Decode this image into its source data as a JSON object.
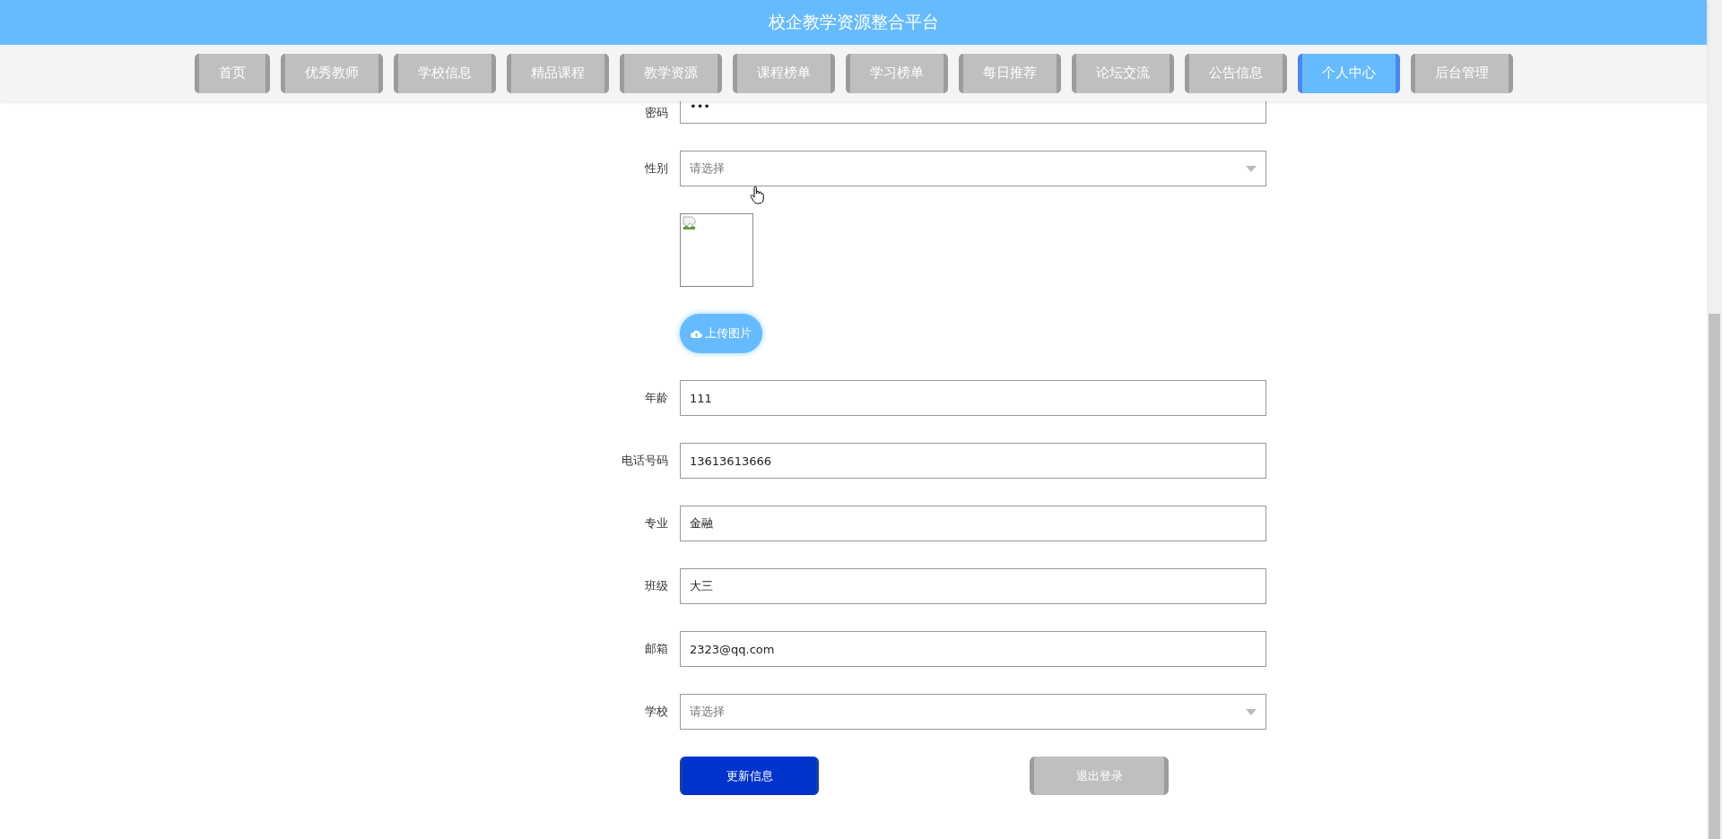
{
  "header": {
    "title": "校企教学资源整合平台"
  },
  "nav": [
    {
      "label": "首页",
      "selected": false
    },
    {
      "label": "优秀教师",
      "selected": false
    },
    {
      "label": "学校信息",
      "selected": false
    },
    {
      "label": "精品课程",
      "selected": false
    },
    {
      "label": "教学资源",
      "selected": false
    },
    {
      "label": "课程榜单",
      "selected": false
    },
    {
      "label": "学习榜单",
      "selected": false
    },
    {
      "label": "每日推荐",
      "selected": false
    },
    {
      "label": "论坛交流",
      "selected": false
    },
    {
      "label": "公告信息",
      "selected": false
    },
    {
      "label": "个人中心",
      "selected": true
    },
    {
      "label": "后台管理",
      "selected": false
    }
  ],
  "form": {
    "fields": [
      {
        "kind": "text",
        "label": "密码",
        "value": "•••"
      },
      {
        "kind": "select",
        "label": "性别",
        "placeholder": "请选择"
      },
      {
        "kind": "image",
        "upload_label": "上传图片"
      },
      {
        "kind": "text",
        "label": "年龄",
        "value": "111"
      },
      {
        "kind": "text",
        "label": "电话号码",
        "value": "13613613666"
      },
      {
        "kind": "text",
        "label": "专业",
        "value": "金融"
      },
      {
        "kind": "text",
        "label": "班级",
        "value": "大三"
      },
      {
        "kind": "text",
        "label": "邮箱",
        "value": "2323@qq.com"
      },
      {
        "kind": "select",
        "label": "学校",
        "placeholder": "请选择"
      }
    ],
    "buttons": [
      {
        "kind": "primary",
        "label": "更新信息"
      },
      {
        "kind": "secondary",
        "label": "退出登录"
      }
    ]
  }
}
